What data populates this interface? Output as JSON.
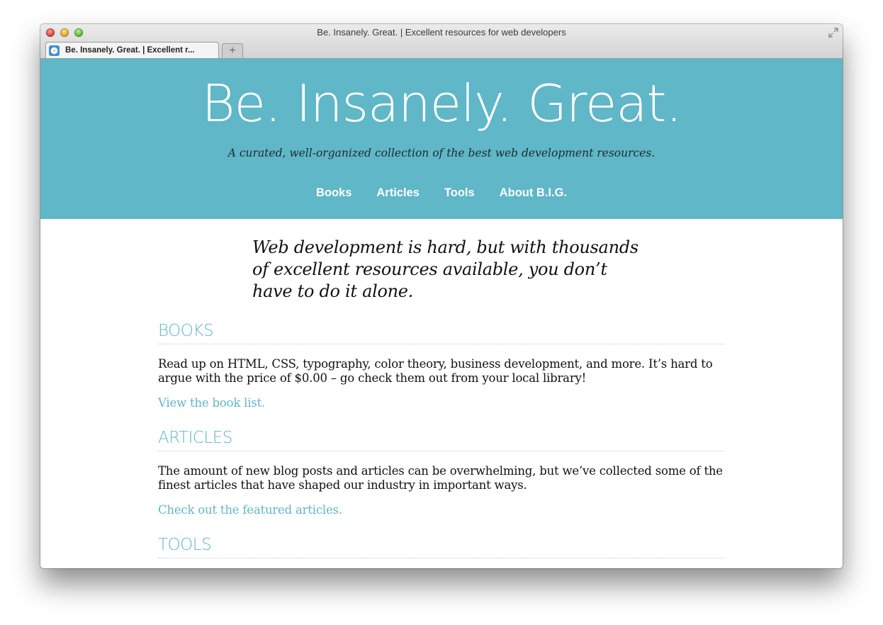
{
  "window": {
    "title": "Be. Insanely. Great. | Excellent resources for web developers",
    "tab_label": "Be. Insanely. Great. | Excellent r...",
    "new_tab_icon": "+"
  },
  "hero": {
    "title": "Be. Insanely. Great.",
    "tagline": "A curated, well-organized collection of the best web development resources.",
    "nav": [
      "Books",
      "Articles",
      "Tools",
      "About B.I.G."
    ]
  },
  "intro": "Web development is hard, but with thousands of excellent resources available, you don’t have to do it alone.",
  "sections": [
    {
      "heading": "BOOKS",
      "body": "Read up on HTML, CSS, typography, color theory, business development, and more. It’s hard to argue with the price of $0.00 – go check them out from your local library!",
      "link": "View the book list."
    },
    {
      "heading": "ARTICLES",
      "body": "The amount of new blog posts and articles can be overwhelming, but we’ve collected some of the finest articles that have shaped our industry in important ways.",
      "link": "Check out the featured articles."
    },
    {
      "heading": "TOOLS"
    }
  ],
  "colors": {
    "accent": "#5fb7c8",
    "text": "#111111",
    "hero_text": "#ffffff"
  }
}
